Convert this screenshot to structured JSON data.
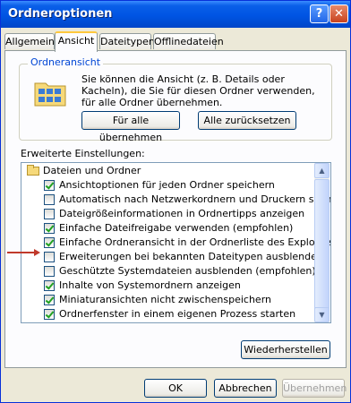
{
  "window": {
    "title": "Ordneroptionen",
    "help_label": "?",
    "close_label": "✕"
  },
  "tabs": [
    {
      "label": "Allgemein"
    },
    {
      "label": "Ansicht"
    },
    {
      "label": "Dateitypen"
    },
    {
      "label": "Offlinedateien"
    }
  ],
  "folder_view": {
    "group_label": "Ordneransicht",
    "description": "Sie können die Ansicht (z. B. Details oder Kacheln), die Sie für diesen Ordner verwenden, für alle Ordner übernehmen.",
    "apply_all_label": "Für alle übernehmen",
    "reset_all_label": "Alle zurücksetzen"
  },
  "advanced": {
    "label": "Erweiterte Einstellungen:",
    "category": "Dateien und Ordner",
    "items": [
      {
        "label": "Ansichtoptionen für jeden Ordner speichern",
        "checked": true
      },
      {
        "label": "Automatisch nach Netzwerkordnern und Druckern suchen",
        "checked": false
      },
      {
        "label": "Dateigrößeinformationen in Ordnertipps anzeigen",
        "checked": false
      },
      {
        "label": "Einfache Dateifreigabe verwenden (empfohlen)",
        "checked": true
      },
      {
        "label": "Einfache Ordneransicht in der Ordnerliste des Explorers anzeigen",
        "checked": true
      },
      {
        "label": "Erweiterungen bei bekannten Dateitypen ausblenden",
        "checked": false
      },
      {
        "label": "Geschützte Systemdateien ausblenden (empfohlen)",
        "checked": false
      },
      {
        "label": "Inhalte von Systemordnern anzeigen",
        "checked": true
      },
      {
        "label": "Miniaturansichten nicht zwischenspeichern",
        "checked": true
      },
      {
        "label": "Ordnerfenster in einem eigenen Prozess starten",
        "checked": true
      }
    ],
    "restore_label": "Wiederherstellen"
  },
  "footer": {
    "ok_label": "OK",
    "cancel_label": "Abbrechen",
    "apply_label": "Übernehmen"
  },
  "colors": {
    "accent": "#0054E3",
    "annotation_arrow": "#C0392B",
    "check": "#21A121"
  }
}
